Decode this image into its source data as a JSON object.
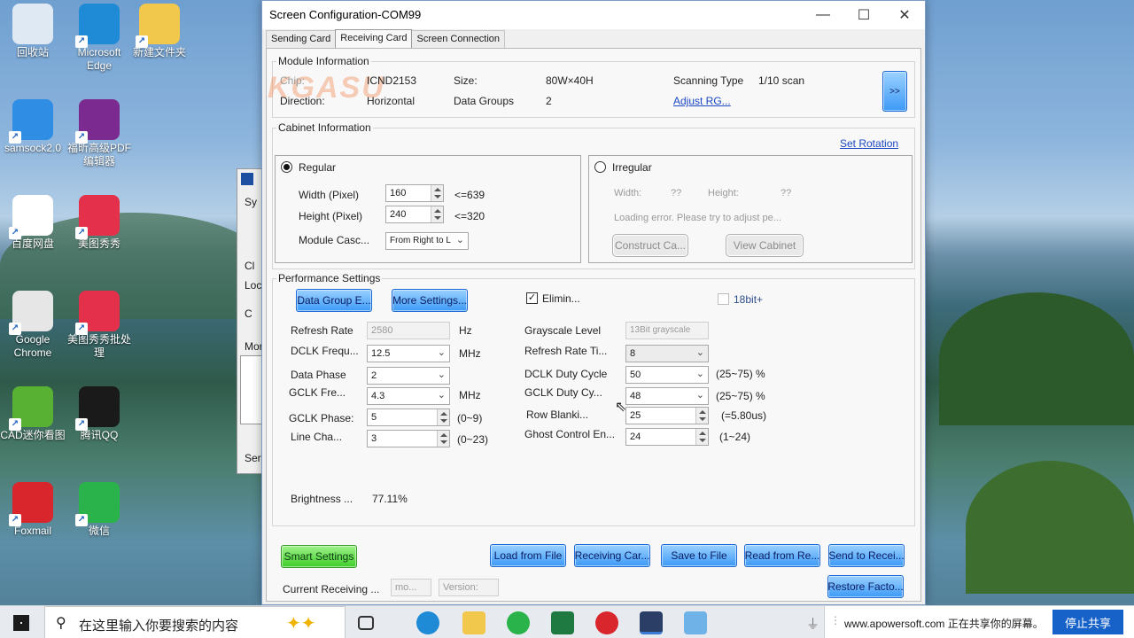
{
  "desktop_icons": [
    {
      "label": "回收站",
      "icon": "recycle-bin-icon",
      "color": "#dfe9f3"
    },
    {
      "label": "Microsoft Edge",
      "icon": "edge-icon",
      "color": "#1f8ad6"
    },
    {
      "label": "新建文件夹",
      "icon": "folder-icon",
      "color": "#f1c84b"
    },
    {
      "label": "samsock2.0",
      "icon": "rocket-icon",
      "color": "#2f8de4"
    },
    {
      "label": "福昕高级PDF编辑器",
      "icon": "pdf-editor-icon",
      "color": "#7b2a8f"
    },
    {
      "label": "百度网盘",
      "icon": "baidu-pan-icon",
      "color": "#ffffff"
    },
    {
      "label": "美图秀秀",
      "icon": "meitu-icon",
      "color": "#e4304a"
    },
    {
      "label": "Google Chrome",
      "icon": "chrome-icon",
      "color": "#e6e6e6"
    },
    {
      "label": "美图秀秀批处理",
      "icon": "meitu-batch-icon",
      "color": "#e4304a"
    },
    {
      "label": "CAD迷你看图",
      "icon": "cad-viewer-icon",
      "color": "#59b133"
    },
    {
      "label": "腾讯QQ",
      "icon": "qq-icon",
      "color": "#1a1a1a"
    },
    {
      "label": "Foxmail",
      "icon": "foxmail-icon",
      "color": "#d8262c"
    },
    {
      "label": "微信",
      "icon": "wechat-icon",
      "color": "#29b34a"
    }
  ],
  "bg_window": {
    "labels": [
      "Sy",
      "Cl",
      "Loc",
      "C",
      "Mor",
      "Serv"
    ]
  },
  "dialog": {
    "title": "Screen Configuration-COM99",
    "tabs": [
      "Sending Card",
      "Receiving Card",
      "Screen Connection"
    ],
    "module": {
      "group_label": "Module Information",
      "chip_label": "Chip:",
      "chip_value": "ICND2153",
      "size_label": "Size:",
      "size_value": "80W×40H",
      "scanning_label": "Scanning Type",
      "scanning_value": "1/10 scan",
      "direction_label": "Direction:",
      "direction_value": "Horizontal",
      "datagroups_label": "Data Groups",
      "datagroups_value": "2",
      "adjust_link": "Adjust RG...",
      "expand_button": ">>",
      "watermark": "KGASU"
    },
    "cabinet": {
      "group_label": "Cabinet Information",
      "set_rotation": "Set Rotation",
      "regular_label": "Regular",
      "width_label": "Width (Pixel)",
      "width_value": "160",
      "width_hint": "<=639",
      "height_label": "Height (Pixel)",
      "height_value": "240",
      "height_hint": "<=320",
      "cascade_label": "Module Casc...",
      "cascade_value": "From Right to L",
      "irregular_label": "Irregular",
      "irr_width_label": "Width:",
      "irr_width_value": "??",
      "irr_height_label": "Height:",
      "irr_height_value": "??",
      "loading_error": "Loading error. Please try to adjust pe...",
      "construct_button": "Construct Ca...",
      "view_button": "View Cabinet"
    },
    "performance": {
      "group_label": "Performance Settings",
      "data_group_button": "Data Group E...",
      "more_settings_button": "More Settings...",
      "elimin_label": "Elimin...",
      "elimin_checked": "✓",
      "bit18_label": "18bit+",
      "refresh_rate_label": "Refresh Rate",
      "refresh_rate_value": "2580",
      "refresh_rate_unit": "Hz",
      "dclk_freq_label": "DCLK Frequ...",
      "dclk_freq_value": "12.5",
      "dclk_freq_unit": "MHz",
      "data_phase_label": "Data Phase",
      "data_phase_value": "2",
      "gclk_freq_label": "GCLK Fre...",
      "gclk_freq_value": "4.3",
      "gclk_freq_unit": "MHz",
      "gclk_phase_label": "GCLK Phase:",
      "gclk_phase_value": "5",
      "gclk_phase_range": "(0~9)",
      "line_change_label": "Line Cha...",
      "line_change_value": "3",
      "line_change_range": "(0~23)",
      "grayscale_label": "Grayscale Level",
      "grayscale_value": "13Bit grayscale",
      "refresh_times_label": "Refresh Rate Ti...",
      "refresh_times_value": "8",
      "dclk_duty_label": "DCLK Duty Cycle",
      "dclk_duty_value": "50",
      "dclk_duty_range": "(25~75) %",
      "gclk_duty_label": "GCLK Duty Cy...",
      "gclk_duty_value": "48",
      "gclk_duty_range": "(25~75) %",
      "row_blank_label": "Row Blanki...",
      "row_blank_value": "25",
      "row_blank_range": "(=5.80us)",
      "ghost_label": "Ghost Control En...",
      "ghost_value": "24",
      "ghost_range": "(1~24)",
      "brightness_label": "Brightness ...",
      "brightness_value": "77.11%"
    },
    "footer": {
      "smart_settings": "Smart Settings",
      "load_from_file": "Load from File",
      "receiving_card": "Receiving Car...",
      "save_to_file": "Save to File",
      "read_from": "Read from Re...",
      "send_to": "Send to Recei...",
      "restore": "Restore Facto...",
      "current_receiving_label": "Current Receiving ...",
      "model_placeholder": "mo...",
      "version_placeholder": "Version:"
    }
  },
  "taskbar": {
    "search_placeholder": "在这里输入你要搜索的内容",
    "share_text": "www.apowersoft.com 正在共享你的屏幕。",
    "stop_share": "停止共享",
    "apps": [
      "task-view-icon",
      "edge-icon",
      "file-explorer-icon",
      "wechat-icon",
      "excel-icon",
      "foxmail-icon",
      "led-config-icon",
      "paint-icon"
    ]
  }
}
